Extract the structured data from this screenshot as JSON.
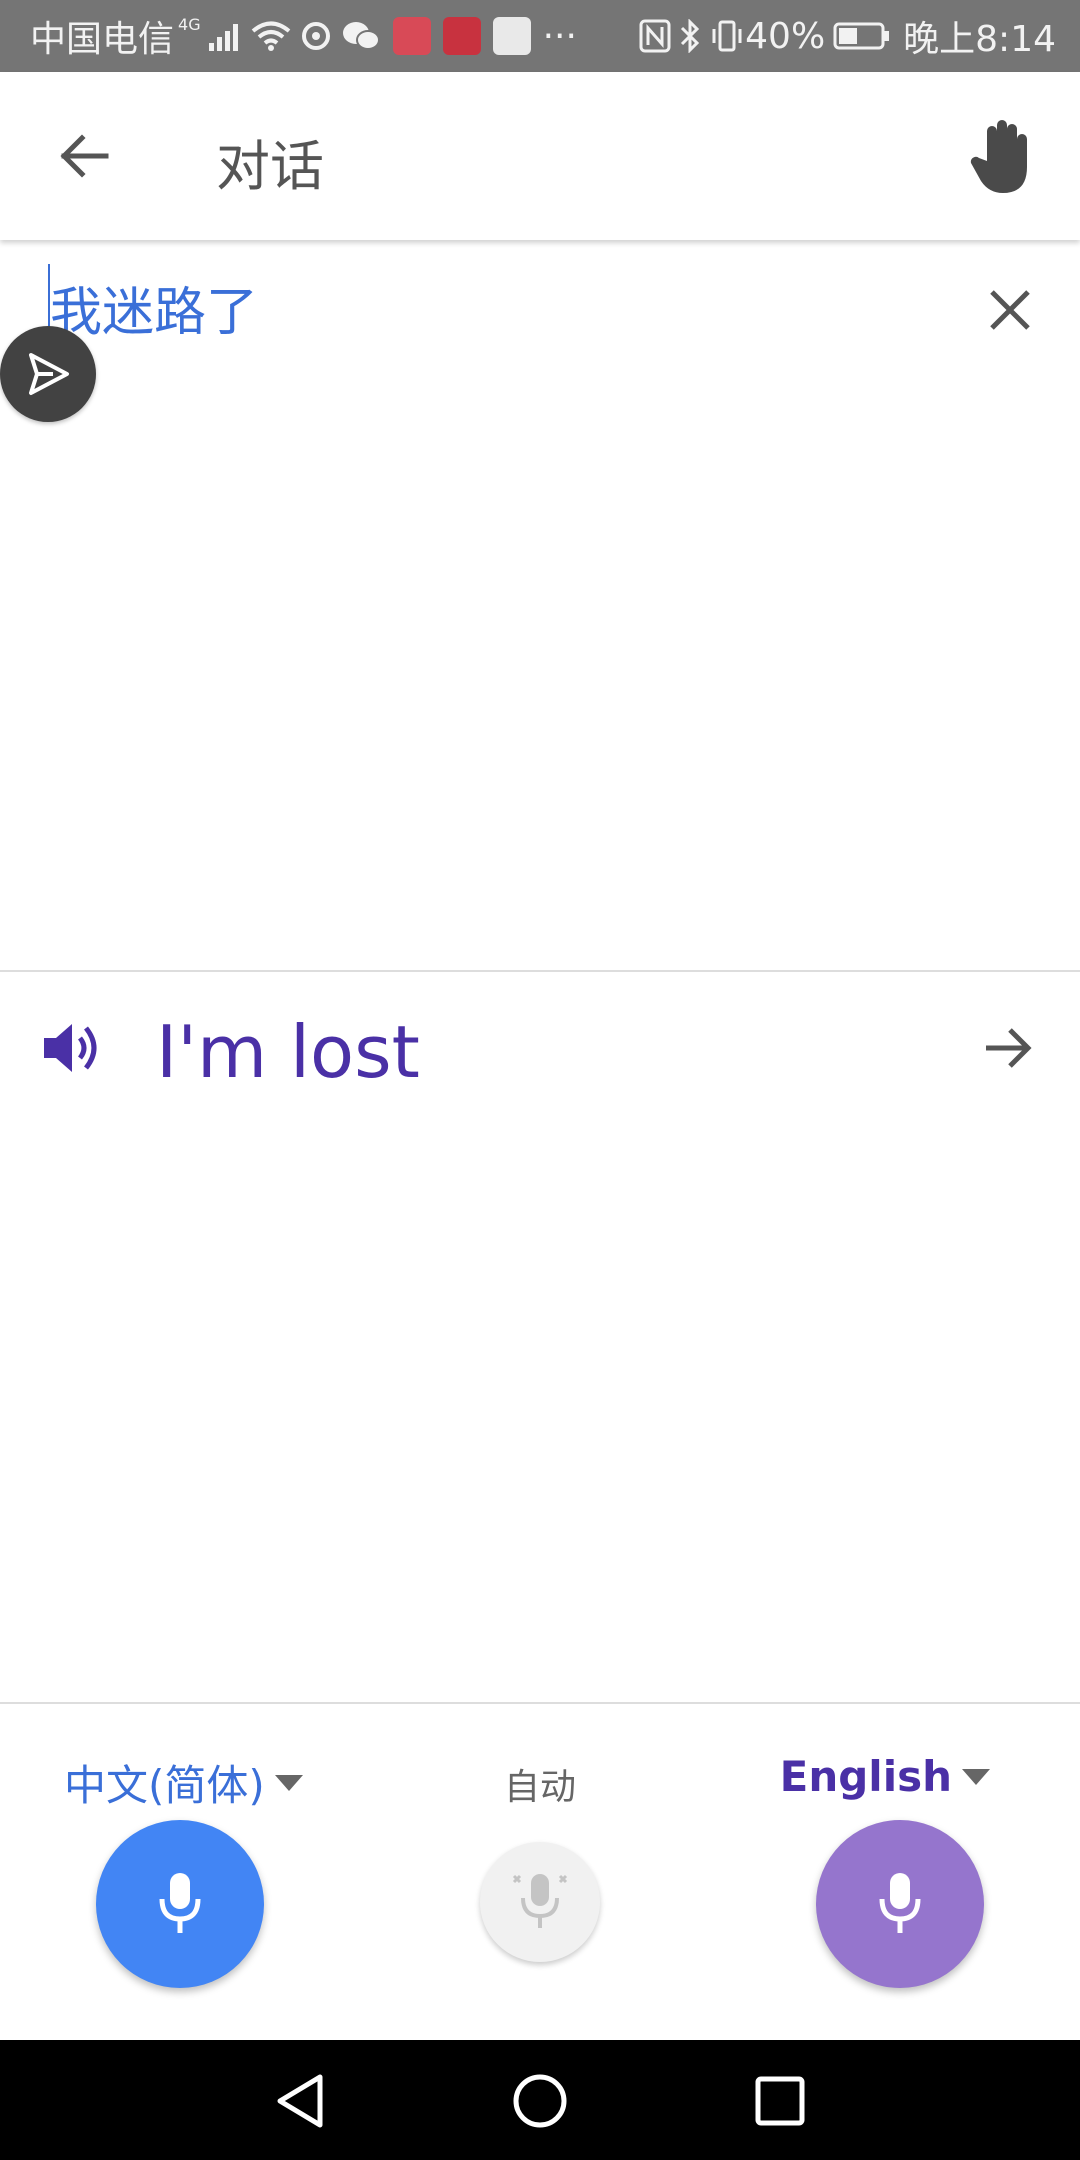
{
  "status_bar": {
    "carrier": "中国电信",
    "network": "4G",
    "battery": "40%",
    "time": "晚上8:14",
    "more": "···"
  },
  "app_bar": {
    "title": "对话",
    "back_icon": "arrow-back-icon",
    "hand_icon": "hand-icon"
  },
  "source": {
    "text": "我迷路了",
    "clear_icon": "close-icon",
    "send_icon": "send-icon"
  },
  "translation": {
    "text": "I'm lost",
    "speaker_icon": "speaker-icon",
    "forward_icon": "arrow-forward-icon"
  },
  "controls": {
    "left_language": "中文(简体)",
    "auto_label": "自动",
    "right_language": "English",
    "left_mic_color": "#4285f4",
    "right_mic_color": "#9575cd",
    "auto_mic_color": "#f1f1f1"
  },
  "colors": {
    "source_text": "#3a6fd8",
    "target_text": "#4a30a6",
    "status_bar_bg": "#757575"
  }
}
